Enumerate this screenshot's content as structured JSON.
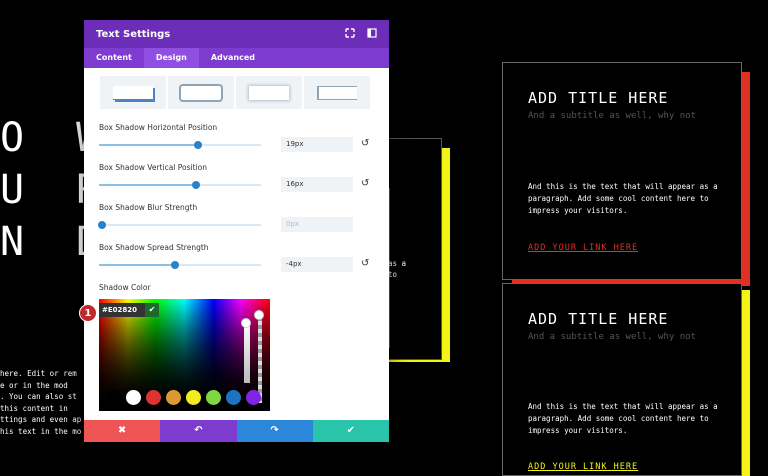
{
  "background": {
    "big_letters": [
      "O W",
      "U R",
      "N D"
    ],
    "left_paragraph": [
      "here. Edit or rem",
      "e or in the mod",
      ". You can also st",
      "this content in",
      "ttings and even ap",
      "his text in the mo"
    ],
    "mid_card_text": [
      "as a",
      "to"
    ]
  },
  "cards": [
    {
      "title": "ADD TITLE HERE",
      "subtitle": "And a subtitle as well, why not",
      "paragraph": "And this is the text that will appear as a paragraph. Add some cool content here to impress your visitors.",
      "link": "ADD YOUR LINK HERE",
      "accent_color": "#e03024"
    },
    {
      "title": "ADD TITLE HERE",
      "subtitle": "And a subtitle as well, why not",
      "paragraph": "And this is the text that will appear as a paragraph. Add some cool content here to impress your visitors.",
      "link": "ADD YOUR LINK HERE",
      "accent_color": "#f3f315"
    }
  ],
  "modal": {
    "title": "Text Settings",
    "header_icons": [
      "expand-icon",
      "sidebar-icon"
    ],
    "tabs": [
      {
        "label": "Content",
        "active": false
      },
      {
        "label": "Design",
        "active": true
      },
      {
        "label": "Advanced",
        "active": false
      }
    ],
    "presets": [
      "preset-1",
      "preset-2",
      "preset-3",
      "preset-4"
    ],
    "fields": [
      {
        "label": "Box Shadow Horizontal Position",
        "value": "19px",
        "level": 0.61,
        "disabled": false
      },
      {
        "label": "Box Shadow Vertical Position",
        "value": "16px",
        "level": 0.6,
        "disabled": false
      },
      {
        "label": "Box Shadow Blur Strength",
        "value": "0px",
        "level": 0.02,
        "disabled": true
      },
      {
        "label": "Box Shadow Spread Strength",
        "value": "-4px",
        "level": 0.47,
        "disabled": false
      }
    ],
    "shadow_color_label": "Shadow Color",
    "hex_value": "#E02820",
    "swatches": [
      "#000000",
      "#ffffff",
      "#dd3333",
      "#dd9933",
      "#eeee22",
      "#81d742",
      "#1e73be",
      "#8224e3"
    ],
    "step_badge": "1",
    "footer_buttons": [
      {
        "icon": "close-icon",
        "glyph": "✖",
        "color": "#ef5555"
      },
      {
        "icon": "undo-icon",
        "glyph": "↶",
        "color": "#7e3bd0"
      },
      {
        "icon": "redo-icon",
        "glyph": "↷",
        "color": "#2b87da"
      },
      {
        "icon": "check-icon",
        "glyph": "✔",
        "color": "#29c4a9"
      }
    ]
  },
  "colors": {
    "modal_header": "#6c2eb9",
    "tab_bar": "#7d3bd0",
    "slider_knob": "#2a82c9",
    "yellow_accent": "#f3f315",
    "red_accent": "#e03024"
  }
}
